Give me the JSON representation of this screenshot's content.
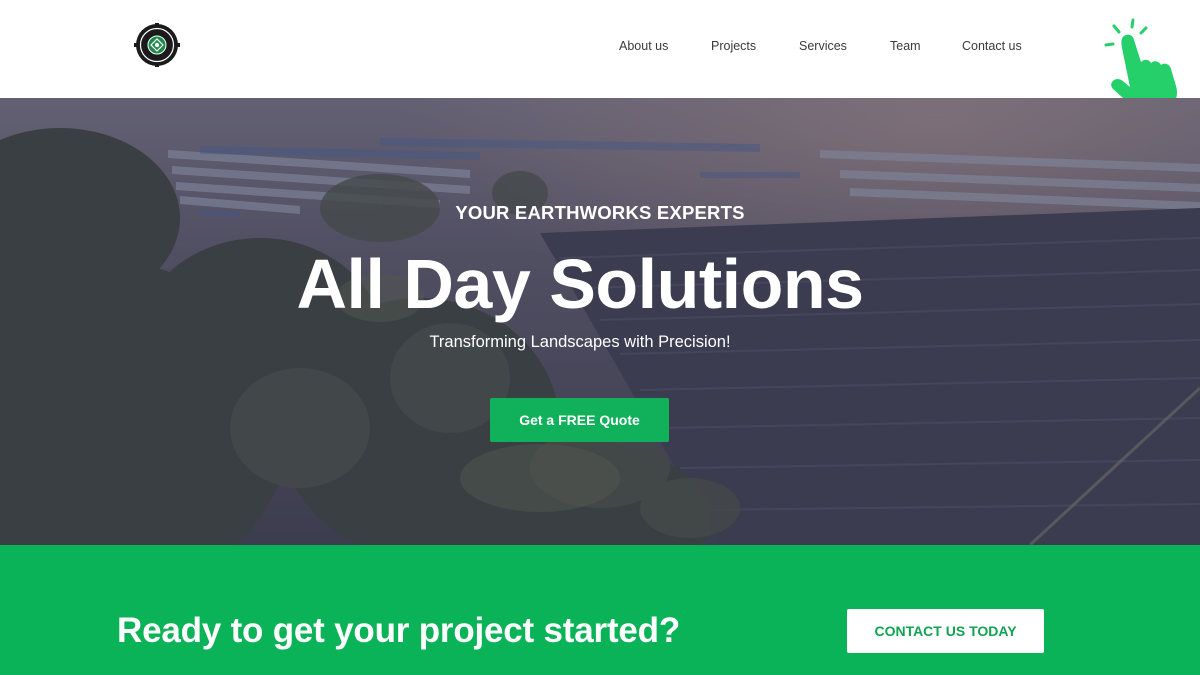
{
  "header": {
    "logo_icon": "company-seal-logo",
    "nav": [
      {
        "label": "About us"
      },
      {
        "label": "Projects"
      },
      {
        "label": "Services"
      },
      {
        "label": "Team"
      },
      {
        "label": "Contact us"
      }
    ],
    "pointer_icon": "tap-hand-icon"
  },
  "hero": {
    "eyebrow": "YOUR EARTHWORKS EXPERTS",
    "title": "All Day Solutions",
    "subtitle": "Transforming Landscapes with Precision!",
    "cta_label": "Get a FREE Quote",
    "background_icon": "solar-farm-landscape-photo"
  },
  "cta_band": {
    "title": "Ready to get your project started?",
    "button_label": "CONTACT US TODAY"
  },
  "colors": {
    "accent": "#0bb358",
    "button_green": "#10b15a",
    "nav_text": "#3a3a3a",
    "hand_icon": "#25cf6a"
  }
}
